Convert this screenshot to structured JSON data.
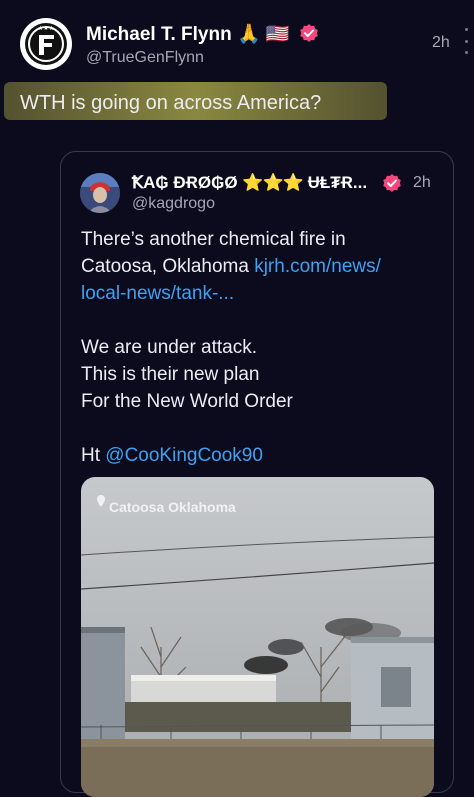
{
  "post": {
    "author_name": "Michael T. Flynn",
    "author_emoji": "🙏 🇺🇸",
    "handle": "@TrueGenFlynn",
    "time": "2h",
    "text": "WTH is going on across America?"
  },
  "quote": {
    "author_name": "ꝀA₲ ĐɌØ₲Ø",
    "author_stars": "⭐⭐⭐",
    "author_suffix": "ɄⱠ₮Ɍ...",
    "handle": "@kagdrogo",
    "time": "2h",
    "line1": "There’s another chemical fire in",
    "line2_text": "Catoosa, Oklahoma ",
    "line2_link": "kjrh.com/news/",
    "line3_link": "local-news/tank-...",
    "line4": "We are under attack.",
    "line5": "This is their new plan",
    "line6": "For the New World Order",
    "ht_label": "Ht ",
    "ht_mention": "@CooKingCook90",
    "media_location": "Catoosa Oklahoma"
  },
  "colors": {
    "background": "#0c0b1d",
    "link": "#3ea1f2",
    "verified": "#f7467e",
    "highlight": "#a09e46"
  },
  "icons": {
    "verified": "verified-badge-icon",
    "location": "location-pin-icon",
    "more": "more-options-icon"
  }
}
